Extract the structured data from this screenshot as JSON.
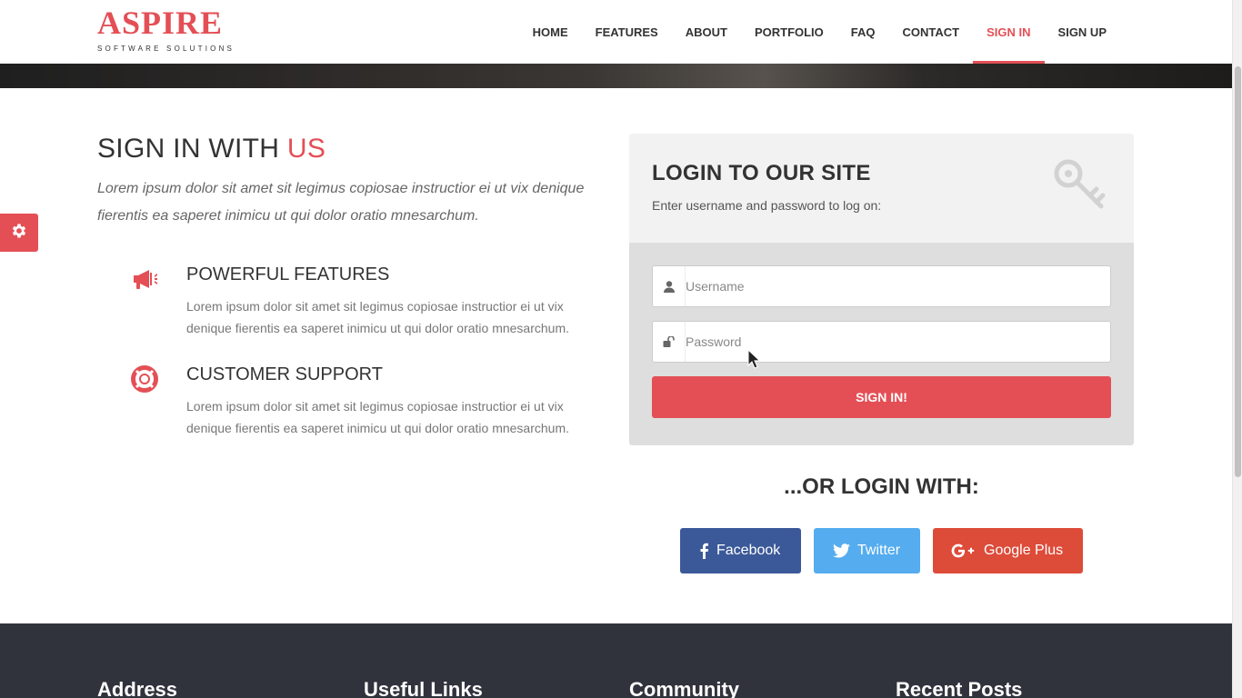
{
  "brand": {
    "name": "ASPIRE",
    "tagline": "SOFTWARE SOLUTIONS",
    "accent_color": "#e44f56"
  },
  "nav": {
    "items": [
      {
        "label": "HOME"
      },
      {
        "label": "FEATURES"
      },
      {
        "label": "ABOUT"
      },
      {
        "label": "PORTFOLIO"
      },
      {
        "label": "FAQ"
      },
      {
        "label": "CONTACT"
      },
      {
        "label": "SIGN IN",
        "active": true
      },
      {
        "label": "SIGN UP"
      }
    ]
  },
  "intro": {
    "title_main": "SIGN IN WITH ",
    "title_accent": "US",
    "lead": "Lorem ipsum dolor sit amet sit legimus copiosae instructior ei ut vix denique fierentis ea saperet inimicu ut qui dolor oratio mnesarchum."
  },
  "features": [
    {
      "icon": "megaphone-icon",
      "title": "POWERFUL FEATURES",
      "text": "Lorem ipsum dolor sit amet sit legimus copiosae instructior ei ut vix denique fierentis ea saperet inimicu ut qui dolor oratio mnesarchum."
    },
    {
      "icon": "lifebuoy-icon",
      "title": "CUSTOMER SUPPORT",
      "text": "Lorem ipsum dolor sit amet sit legimus copiosae instructior ei ut vix denique fierentis ea saperet inimicu ut qui dolor oratio mnesarchum."
    }
  ],
  "login": {
    "title": "LOGIN TO OUR SITE",
    "subtitle": "Enter username and password to log on:",
    "username_placeholder": "Username",
    "password_placeholder": "Password",
    "submit_label": "SIGN IN!"
  },
  "social": {
    "title": "...OR LOGIN WITH:",
    "facebook_label": "Facebook",
    "twitter_label": "Twitter",
    "google_label": "Google Plus",
    "colors": {
      "facebook": "#3b5998",
      "twitter": "#55acee",
      "google": "#dd4b39"
    }
  },
  "footer": {
    "columns": [
      "Address",
      "Useful Links",
      "Community",
      "Recent Posts"
    ]
  }
}
